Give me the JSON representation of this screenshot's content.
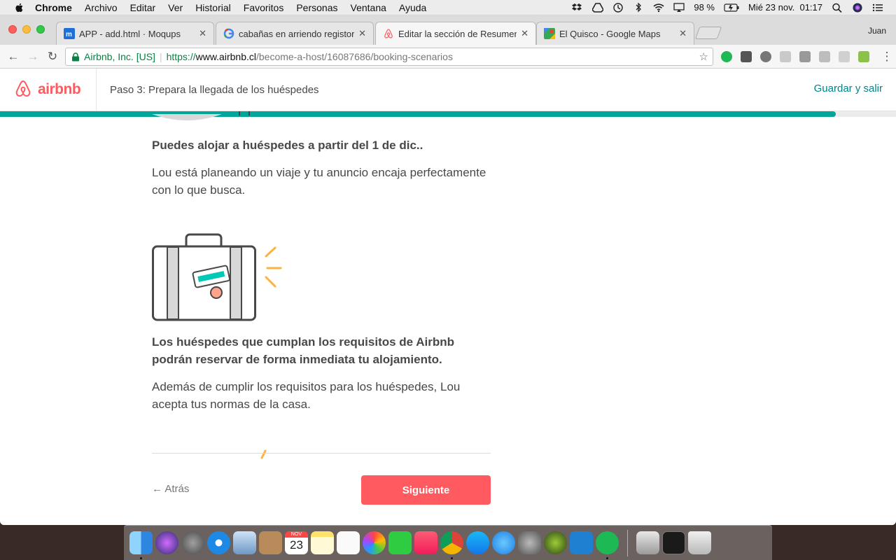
{
  "menubar": {
    "app": "Chrome",
    "items": [
      "Archivo",
      "Editar",
      "Ver",
      "Historial",
      "Favoritos",
      "Personas",
      "Ventana",
      "Ayuda"
    ],
    "battery": "98 %",
    "clock": "Mié 23 nov.  01:17"
  },
  "browser": {
    "tabs": [
      {
        "title": "APP - add.html · Moqups",
        "icon": "moqups-icon"
      },
      {
        "title": "cabañas en arriendo registor -",
        "icon": "google-icon"
      },
      {
        "title": "Editar la sección de Resumen d",
        "icon": "airbnb-icon"
      },
      {
        "title": "El Quisco - Google Maps",
        "icon": "maps-icon"
      }
    ],
    "profile": "Juan",
    "address": {
      "org": "Airbnb, Inc. [US]",
      "scheme": "https://",
      "host": "www.airbnb.cl",
      "path": "/become-a-host/16087686/booking-scenarios"
    }
  },
  "page": {
    "brand": "airbnb",
    "step_title": "Paso 3: Prepara la llegada de los huéspedes",
    "save_exit": "Guardar y salir",
    "progress": 0.933,
    "section1": {
      "heading": "Puedes alojar a huéspedes a partir del 1 de dic..",
      "body": "Lou está planeando un viaje y tu anuncio encaja perfectamente con lo que busca."
    },
    "section2": {
      "heading": "Los huéspedes que cumplan los requisitos de Airbnb podrán reservar de forma inmediata tu alojamiento.",
      "body": "Además de cumplir los requisitos para los huéspedes, Lou acepta tus normas de la casa."
    },
    "back": "Atrás",
    "next": "Siguiente"
  },
  "colors": {
    "brand": "#ff5a5f",
    "teal": "#008489",
    "progress": "#00a699",
    "accent_yellow": "#fcb23d"
  },
  "dock": {
    "calendar_month": "NOV",
    "calendar_day": "23"
  }
}
